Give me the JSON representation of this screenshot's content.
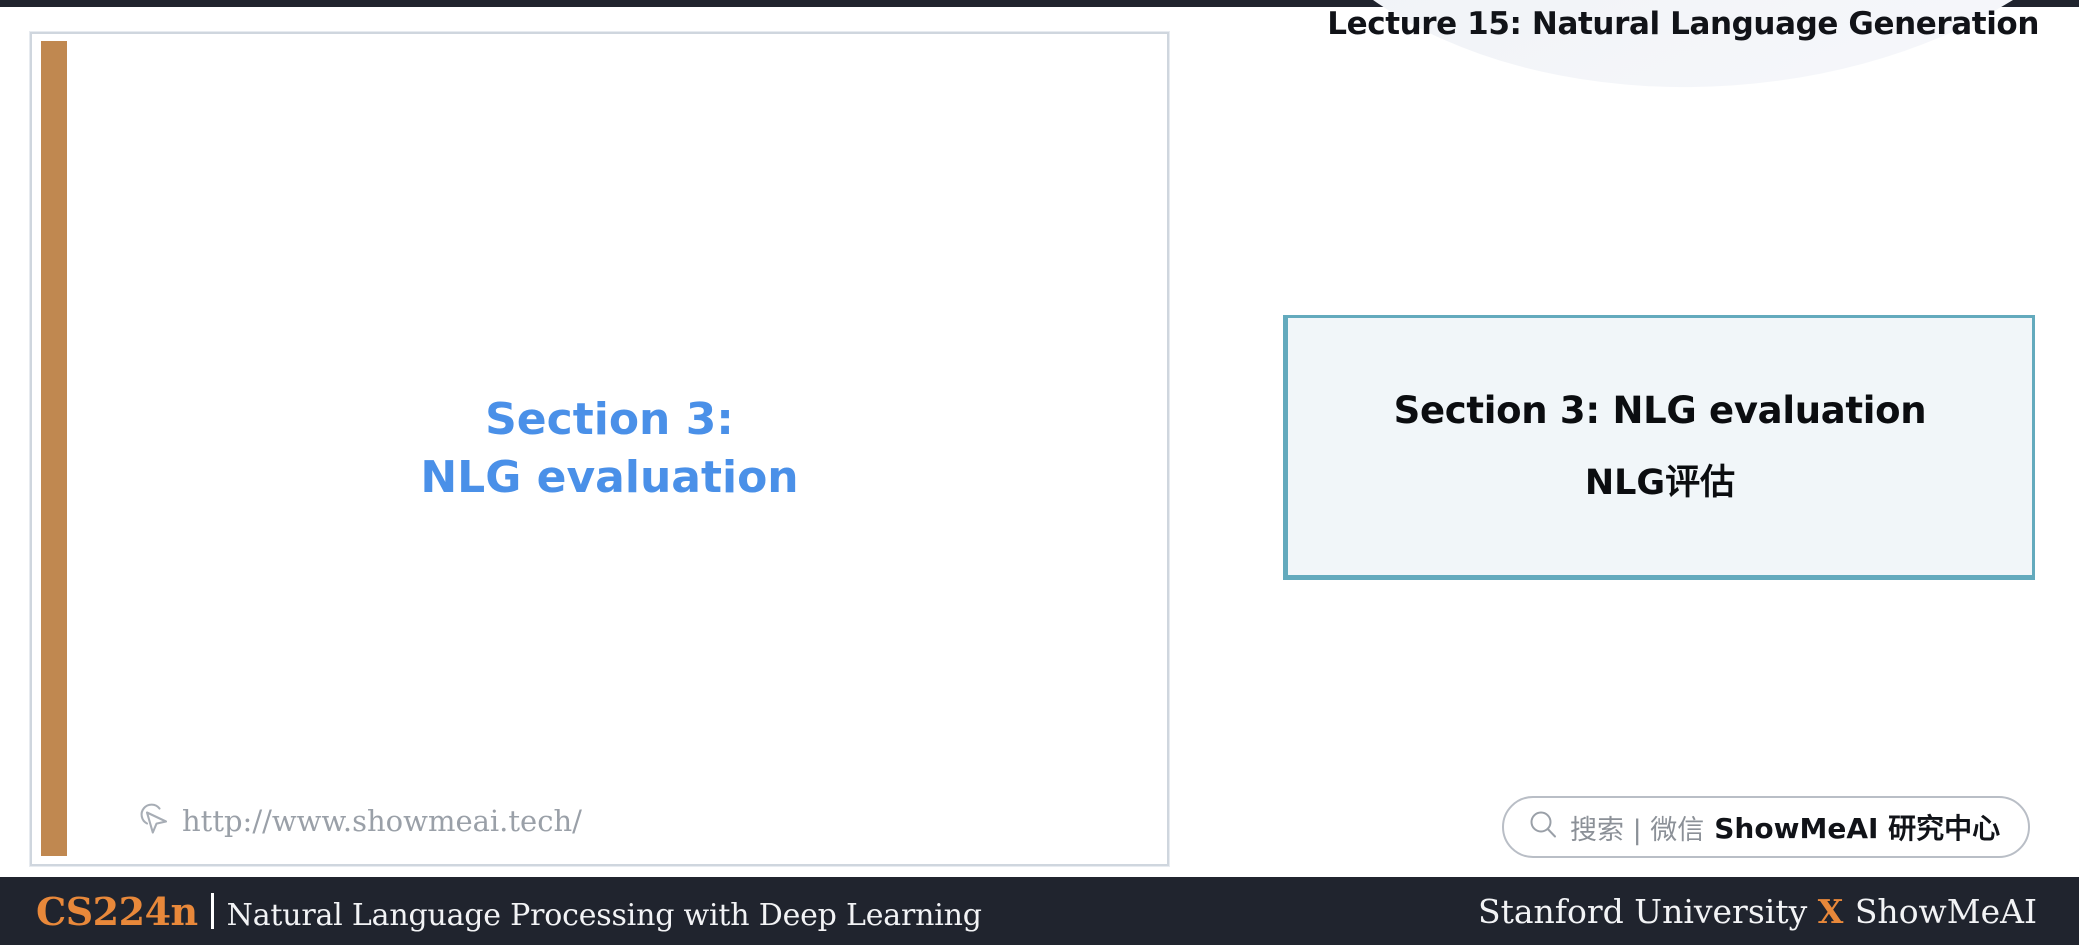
{
  "header": {
    "lecture_title": "Lecture 15: Natural Language Generation"
  },
  "slide": {
    "center_line_1": "Section 3:",
    "center_line_2": "NLG evaluation",
    "watermark_url": "http://www.showmeai.tech/",
    "cursor_icon": "cursor-pointer-icon",
    "accent_color": "#c08850",
    "text_color": "#4a90e8"
  },
  "note_box": {
    "line_en": "Section 3: NLG evaluation",
    "line_zh": "NLG评估",
    "border_color": "#63aabd",
    "background_color": "#f1f6f9"
  },
  "search_pill": {
    "icon": "search-icon",
    "label": "搜索 | 微信",
    "brand": "ShowMeAI 研究中心"
  },
  "footer": {
    "course_code": "CS224n",
    "course_name": "Natural Language Processing with Deep Learning",
    "credit_left": "Stanford University",
    "credit_x": "X",
    "credit_right": "ShowMeAI",
    "background_color": "#20242e",
    "accent_color": "#e8883a"
  }
}
